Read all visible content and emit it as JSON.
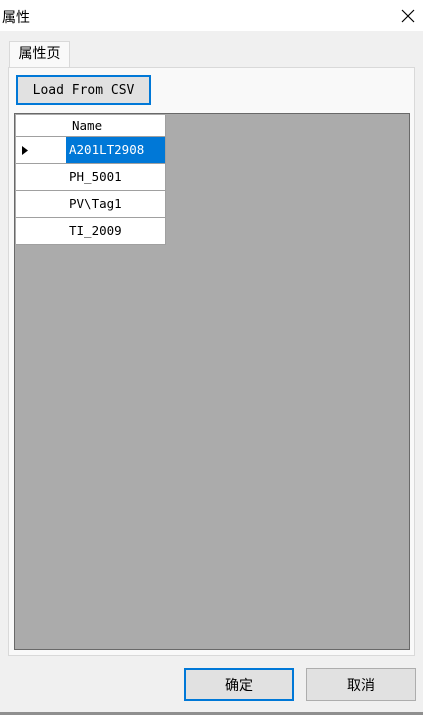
{
  "window": {
    "title": "属性"
  },
  "tabs": [
    {
      "label": "属性页"
    }
  ],
  "toolbar": {
    "load_label": "Load From CSV"
  },
  "grid": {
    "column_header": "Name",
    "rows": [
      {
        "name": "A201LT2908",
        "selected": true
      },
      {
        "name": "PH_5001",
        "selected": false
      },
      {
        "name": "PV\\Tag1",
        "selected": false
      },
      {
        "name": "TI_2009",
        "selected": false
      }
    ]
  },
  "buttons": {
    "ok_label": "确定",
    "cancel_label": "取消"
  },
  "colors": {
    "selection": "#0078d7",
    "grid_background": "#ababab",
    "accent": "#0078d7"
  },
  "icons": {
    "close": "close-icon",
    "row_indicator": "triangle-right-icon"
  }
}
